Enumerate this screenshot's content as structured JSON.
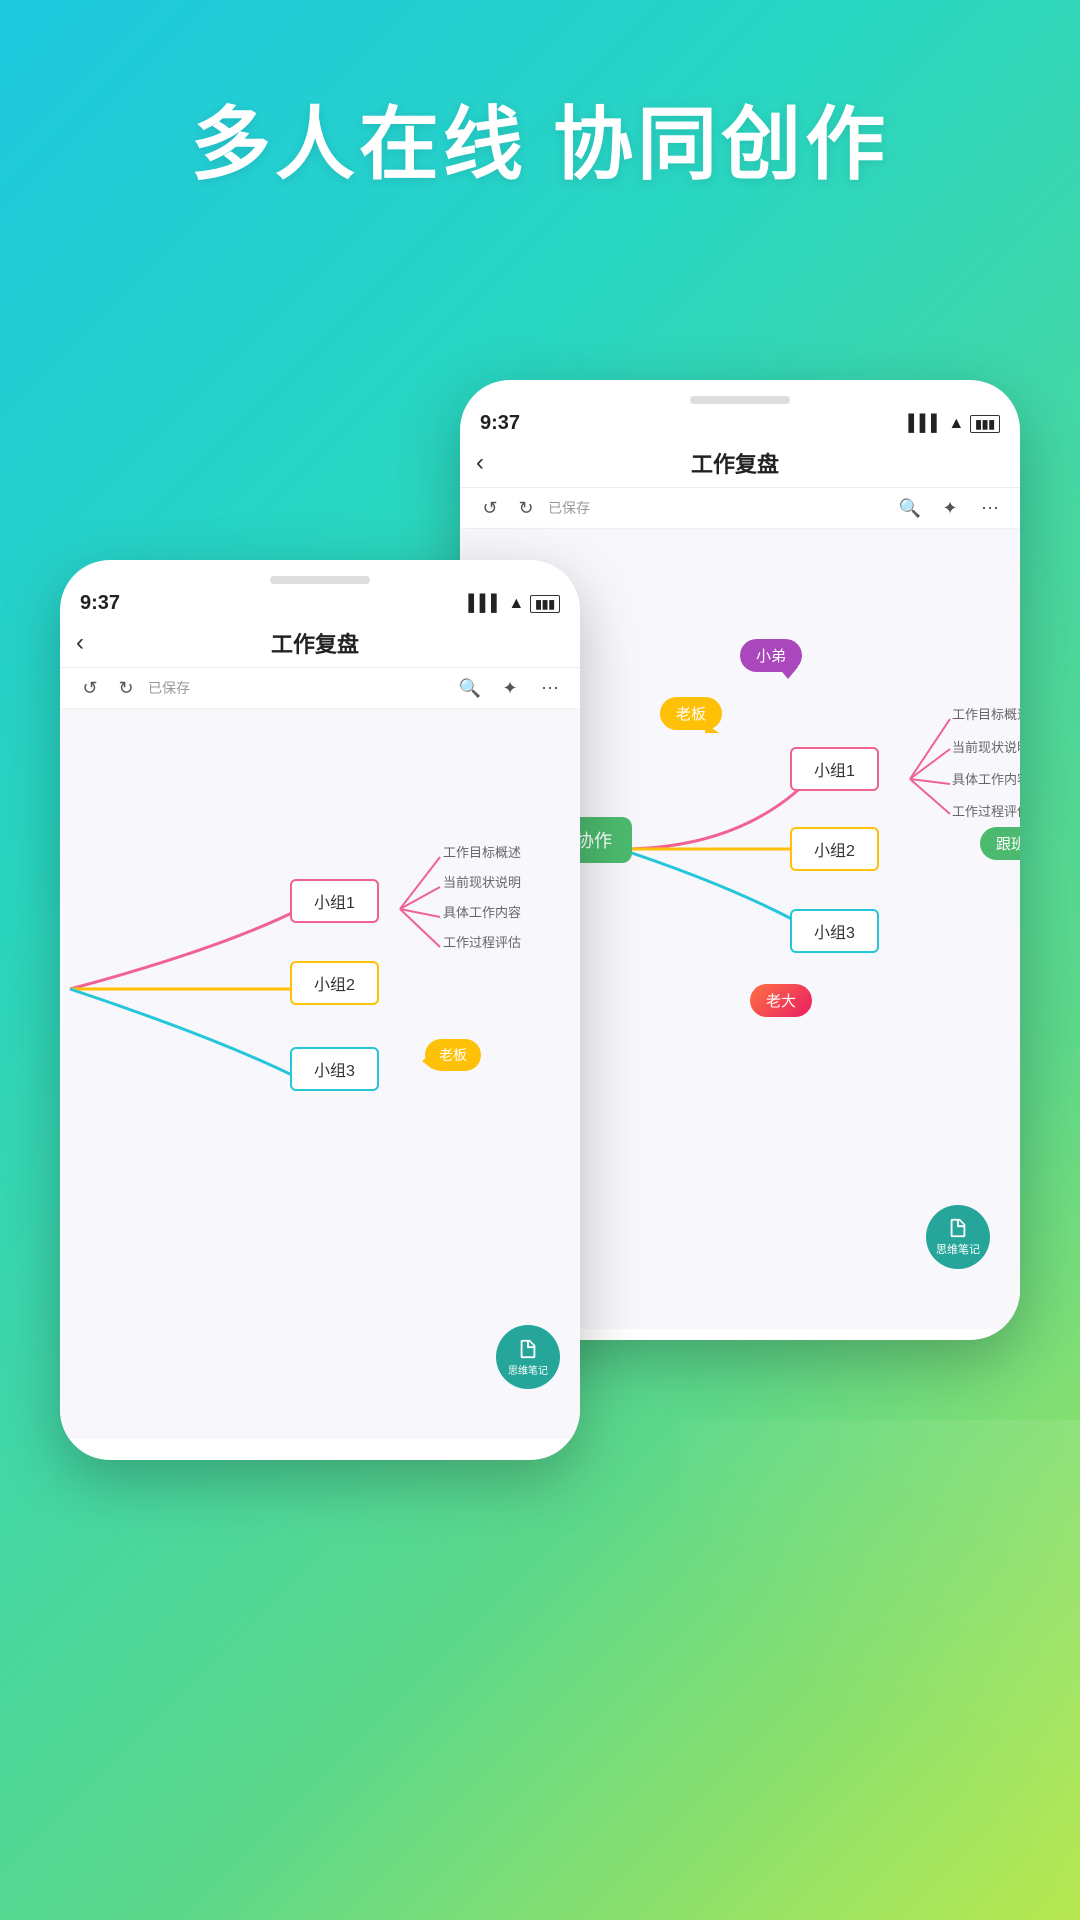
{
  "hero": {
    "line1": "多人在线 协同创作"
  },
  "phone_back": {
    "status_time": "9:37",
    "title": "工作复盘",
    "saved_label": "已保存",
    "nodes": {
      "center": "小组协作",
      "group1": "小组1",
      "group2": "小组2",
      "group3": "小组3",
      "bubble_boss": "老板",
      "bubble_sibling": "小弟",
      "bubble_follow": "跟班",
      "bubble_big": "老大",
      "sub1": "工作目标概述",
      "sub2": "当前现状说明",
      "sub3": "具体工作内容",
      "sub4": "工作过程评估",
      "note_label": "思维笔记"
    }
  },
  "phone_front": {
    "status_time": "9:37",
    "title": "工作复盘",
    "saved_label": "已保存",
    "nodes": {
      "group1": "小组1",
      "group2": "小组2",
      "group3": "小组3",
      "bubble_boss": "老板",
      "sub1": "工作目标概述",
      "sub2": "当前现状说明",
      "sub3": "具体工作内容",
      "sub4": "工作过程评估",
      "note_label": "思维笔记"
    }
  },
  "icons": {
    "back": "‹",
    "undo": "↺",
    "redo": "↻",
    "search": "🔍",
    "share": "✦",
    "more": "⋯",
    "battery": "▮▮▮",
    "wifi": "▲",
    "signal": "▌▌▌"
  }
}
